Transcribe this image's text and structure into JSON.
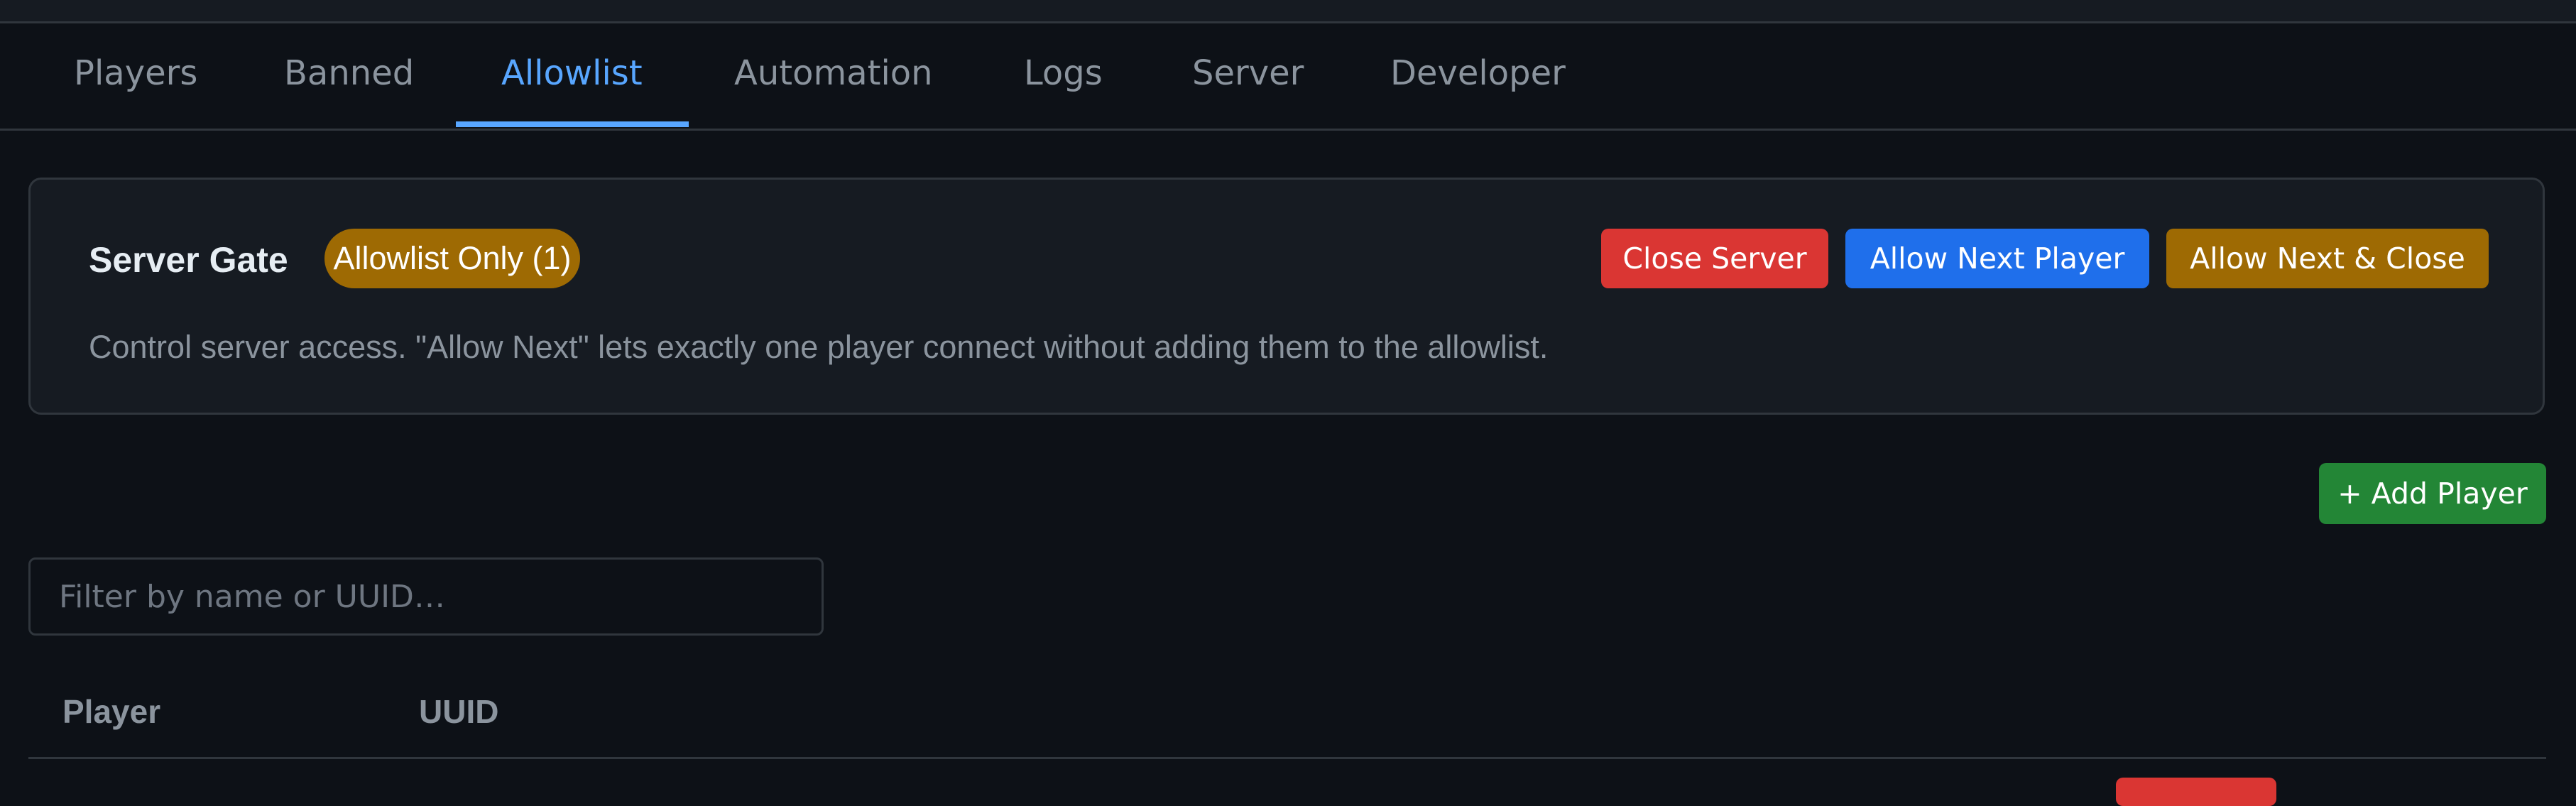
{
  "tabs": [
    {
      "label": "Players"
    },
    {
      "label": "Banned"
    },
    {
      "label": "Allowlist"
    },
    {
      "label": "Automation"
    },
    {
      "label": "Logs"
    },
    {
      "label": "Server"
    },
    {
      "label": "Developer"
    }
  ],
  "active_tab": "Allowlist",
  "gate": {
    "title": "Server Gate",
    "status_badge": "Allowlist Only (1)",
    "description": "Control server access. \"Allow Next\" lets exactly one player connect without adding them to the allowlist.",
    "buttons": {
      "close_server": "Close Server",
      "allow_next": "Allow Next Player",
      "allow_next_close": "Allow Next & Close"
    }
  },
  "add_player_label": "+ Add Player",
  "filter": {
    "placeholder": "Filter by name or UUID…",
    "value": ""
  },
  "table": {
    "columns": [
      "Player",
      "UUID"
    ]
  },
  "colors": {
    "background": "#0d1117",
    "panel": "#161b22",
    "border": "#30363d",
    "accent": "#58a6ff",
    "danger": "#da3633",
    "primary": "#1f6feb",
    "warning": "#9e6a03",
    "success": "#238636"
  }
}
